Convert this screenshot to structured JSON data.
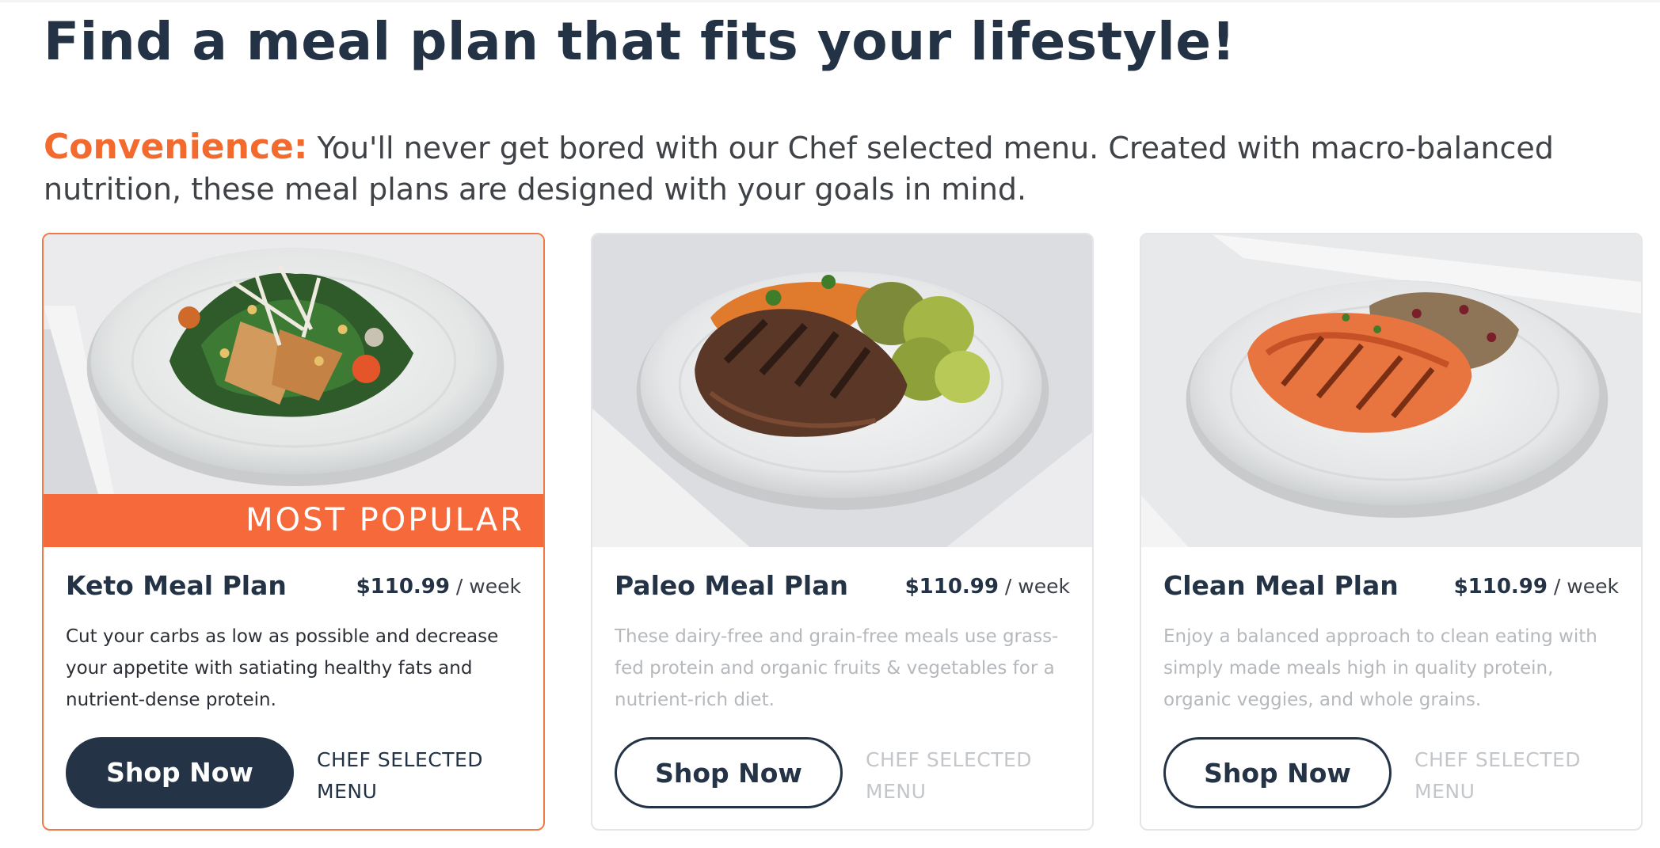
{
  "page": {
    "title": "Find a meal plan that fits your lifestyle!",
    "intro_lead": "Convenience:",
    "intro_text": " You'll never get bored with our Chef selected menu. Created with macro-balanced nutrition, these meal plans are designed with your goals in mind."
  },
  "colors": {
    "accent": "#f26a2e",
    "navy": "#243446",
    "badge": "#f6693a"
  },
  "plans": [
    {
      "name": "Keto Meal Plan",
      "price": "$110.99",
      "per": " / week",
      "badge": "MOST POPULAR",
      "description": "Cut your carbs as low as possible and decrease your appetite with satiating healthy fats and nutrient-dense protein.",
      "button_label": "Shop Now",
      "tag": "CHEF SELECTED MENU",
      "image": "keto-salad-plate"
    },
    {
      "name": "Paleo Meal Plan",
      "price": "$110.99",
      "per": " / week",
      "description": "These dairy-free and grain-free meals use grass-fed protein and organic fruits & vegetables for a nutrient-rich diet.",
      "button_label": "Shop Now",
      "tag": "CHEF SELECTED MENU",
      "image": "paleo-steak-plate"
    },
    {
      "name": "Clean Meal Plan",
      "price": "$110.99",
      "per": " / week",
      "description": "Enjoy a balanced approach to clean eating with simply made meals high in quality protein, organic veggies, and whole grains.",
      "button_label": "Shop Now",
      "tag": "CHEF SELECTED MENU",
      "image": "clean-salmon-plate"
    }
  ]
}
